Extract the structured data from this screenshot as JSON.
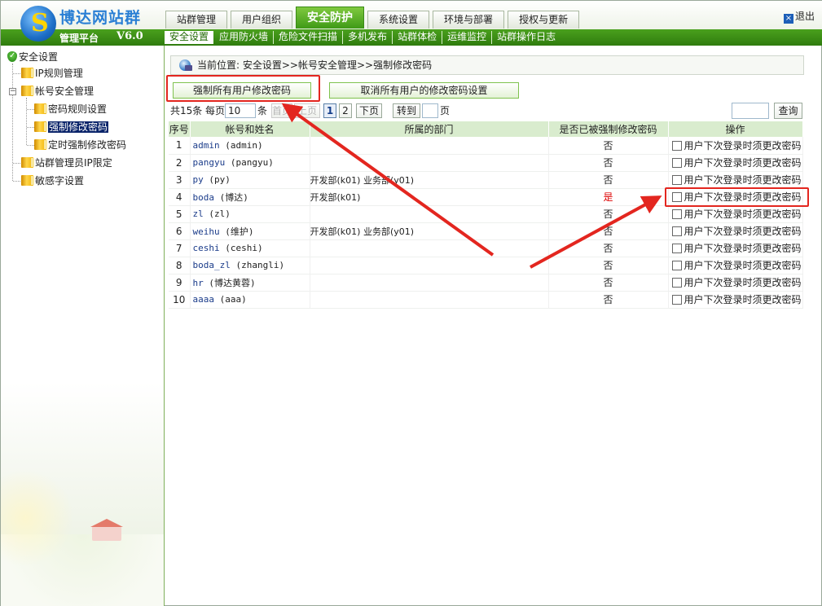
{
  "header": {
    "brand": "博达网站群",
    "platform": "管理平台",
    "version": "V6.0",
    "tabs": [
      {
        "label": "站群管理",
        "active": false
      },
      {
        "label": "用户组织",
        "active": false
      },
      {
        "label": "安全防护",
        "active": true
      },
      {
        "label": "系统设置",
        "active": false
      },
      {
        "label": "环境与部署",
        "active": false
      },
      {
        "label": "授权与更新",
        "active": false
      }
    ],
    "logout": "退出"
  },
  "subnav": [
    {
      "label": "安全设置",
      "active": true
    },
    {
      "label": "应用防火墙",
      "active": false
    },
    {
      "label": "危险文件扫描",
      "active": false
    },
    {
      "label": "多机发布",
      "active": false
    },
    {
      "label": "站群体检",
      "active": false
    },
    {
      "label": "运维监控",
      "active": false
    },
    {
      "label": "站群操作日志",
      "active": false
    }
  ],
  "tree": {
    "root": "安全设置",
    "ip_rules": "IP规则管理",
    "account_mgmt": "帐号安全管理",
    "pwd_rules": "密码规则设置",
    "force_change": "强制修改密码",
    "timed_change": "定时强制修改密码",
    "admin_ip": "站群管理员IP限定",
    "sensitive": "敏感字设置"
  },
  "breadcrumb": "当前位置: 安全设置>>帐号安全管理>>强制修改密码",
  "buttons": {
    "force_all": "强制所有用户修改密码",
    "cancel_all": "取消所有用户的修改密码设置"
  },
  "pager": {
    "total": "共15条",
    "per_page_label": "每页",
    "per_page_value": "10",
    "unit": "条",
    "first": "首页",
    "prev": "上页",
    "pages": [
      "1",
      "2"
    ],
    "current_page": "1",
    "next": "下页",
    "goto": "转到",
    "page_unit": "页",
    "search_btn": "查询"
  },
  "table": {
    "headers": [
      "序号",
      "帐号和姓名",
      "所属的部门",
      "是否已被强制修改密码",
      "操作"
    ],
    "op_label": "用户下次登录时须更改密码",
    "rows": [
      {
        "no": "1",
        "account": "admin",
        "name": "(admin)",
        "dept": "",
        "forced": "否"
      },
      {
        "no": "2",
        "account": "pangyu",
        "name": "(pangyu)",
        "dept": "",
        "forced": "否"
      },
      {
        "no": "3",
        "account": "py",
        "name": "(py)",
        "dept": "开发部(k01) 业务部(y01)",
        "forced": "否"
      },
      {
        "no": "4",
        "account": "boda",
        "name": "(博达)",
        "dept": "开发部(k01)",
        "forced": "是"
      },
      {
        "no": "5",
        "account": "zl",
        "name": "(zl)",
        "dept": "",
        "forced": "否"
      },
      {
        "no": "6",
        "account": "weihu",
        "name": "(维护)",
        "dept": "开发部(k01) 业务部(y01)",
        "forced": "否"
      },
      {
        "no": "7",
        "account": "ceshi",
        "name": "(ceshi)",
        "dept": "",
        "forced": "否"
      },
      {
        "no": "8",
        "account": "boda_zl",
        "name": "(zhangli)",
        "dept": "",
        "forced": "否"
      },
      {
        "no": "9",
        "account": "hr",
        "name": "(博达黄蓉)",
        "dept": "",
        "forced": "否"
      },
      {
        "no": "10",
        "account": "aaaa",
        "name": "(aaa)",
        "dept": "",
        "forced": "否"
      }
    ]
  },
  "colors": {
    "accent_green": "#3f9a17",
    "annotation_red": "#e3261f",
    "yes_red": "#dd0000"
  }
}
